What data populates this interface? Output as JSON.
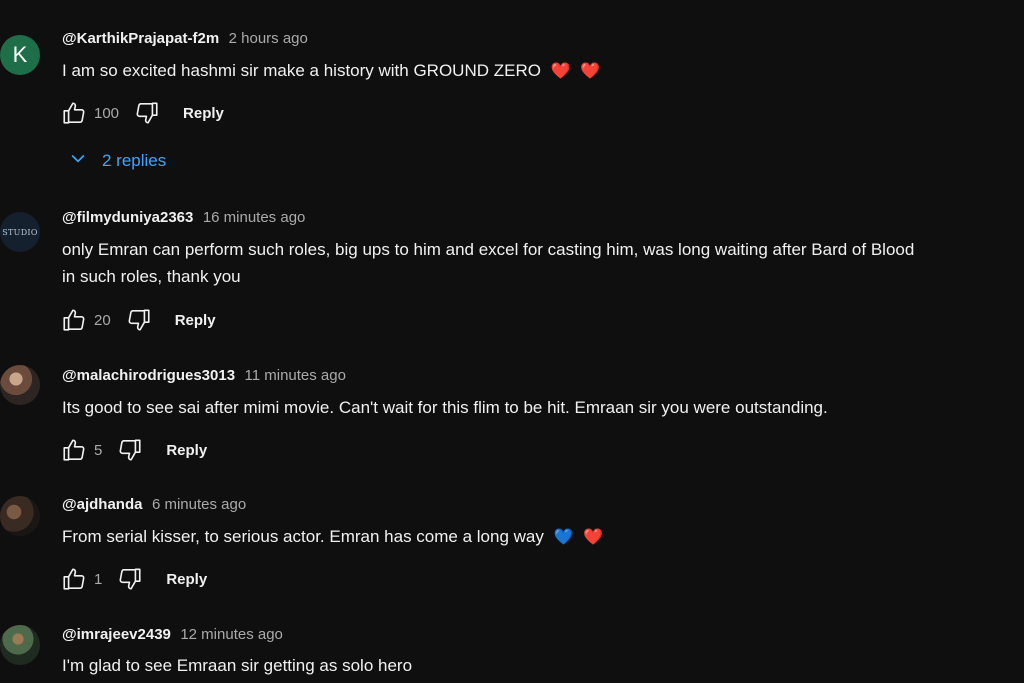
{
  "comments": [
    {
      "author": "@KarthikPrajapat-f2m",
      "time": "2 hours ago",
      "avatar_letter": "K",
      "text": "I am so excited hashmi sir make a history with GROUND ZERO",
      "emojis": [
        "❤️",
        "❤️"
      ],
      "likes": "100",
      "reply_label": "Reply",
      "replies_label": "2 replies"
    },
    {
      "author": "@filmyduniya2363",
      "time": "16 minutes ago",
      "avatar_text": "STUDIO",
      "text_line1": "only Emran can perform such roles, big ups to him and excel for casting him, was long waiting after Bard of Blood",
      "text_line2": "in such roles, thank you",
      "likes": "20",
      "reply_label": "Reply"
    },
    {
      "author": "@malachirodrigues3013",
      "time": "11 minutes ago",
      "text": "Its good to see sai after mimi movie. Can't wait for this flim to be hit. Emraan sir you were outstanding.",
      "likes": "5",
      "reply_label": "Reply"
    },
    {
      "author": "@ajdhanda",
      "time": "6 minutes ago",
      "text": "From serial kisser, to serious actor. Emran has come a long way",
      "emojis": [
        "💙",
        "❤️"
      ],
      "likes": "1",
      "reply_label": "Reply"
    },
    {
      "author": "@imrajeev2439",
      "time": "12 minutes ago",
      "text": "I'm glad to see Emraan sir getting as solo hero"
    }
  ],
  "icons": {
    "like": "thumbs-up-icon",
    "dislike": "thumbs-down-icon",
    "expand": "chevron-down-icon"
  },
  "colors": {
    "background": "#0f0f0f",
    "replies_link": "#3ea6ff",
    "secondary_text": "#aaaaaa"
  }
}
